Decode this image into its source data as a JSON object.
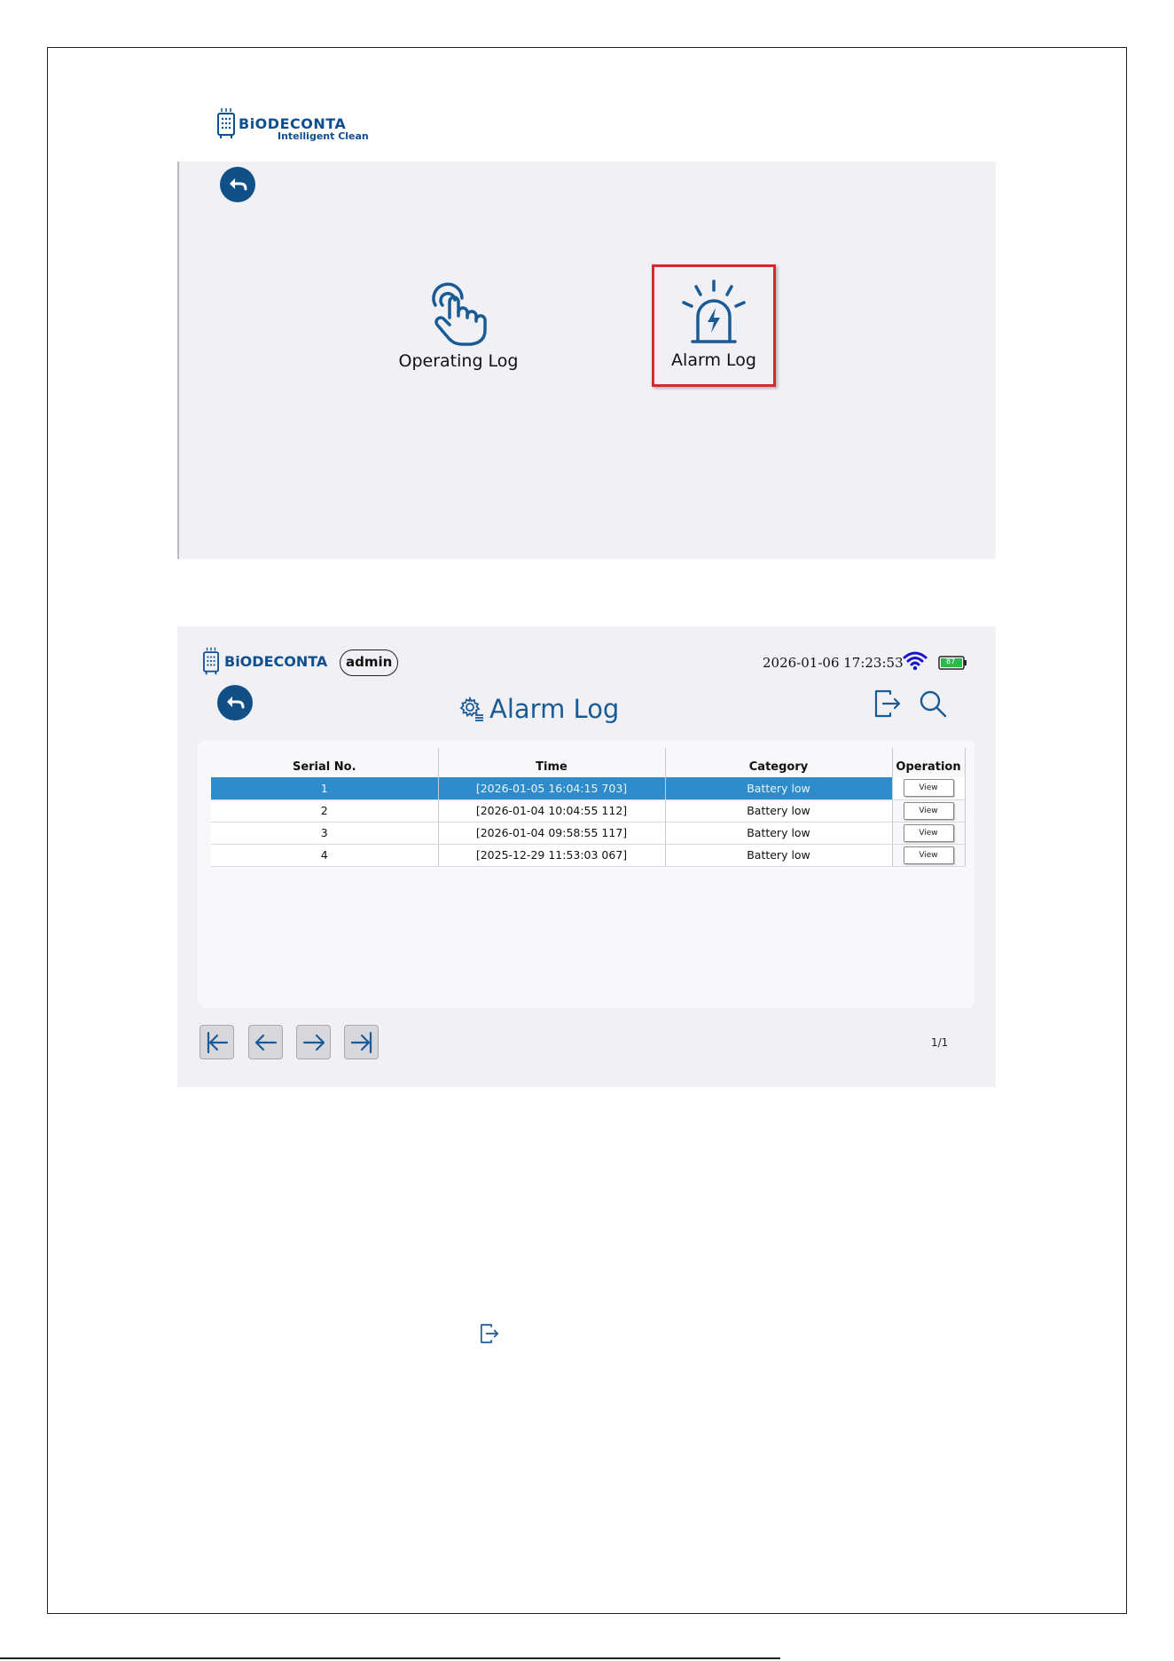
{
  "colors": {
    "brand": "#0f4f8f",
    "title": "#1a5b96",
    "selected_row": "#2f8ccb",
    "highlight_border": "#d42a2a",
    "panel_bg": "#f1f1f5"
  },
  "logo": {
    "brand": "BiODECONTA",
    "tagline": "Intelligent Clean"
  },
  "menu_screen": {
    "back_icon": "back-arrow-icon",
    "tiles": [
      {
        "label": "Operating Log",
        "icon": "hand-pointer-icon",
        "selected": false
      },
      {
        "label": "Alarm Log",
        "icon": "alarm-siren-icon",
        "selected": true
      }
    ]
  },
  "alarm_screen": {
    "header": {
      "brand": "BiODECONTA",
      "user": "admin",
      "datetime": "2026-01-06 17:23:53",
      "battery_level": "87",
      "wifi_icon": "wifi-icon",
      "battery_icon": "battery-icon"
    },
    "title": "Alarm Log",
    "title_icon": "gear-list-icon",
    "toolbar_icons": [
      "export-icon",
      "search-icon"
    ],
    "table": {
      "columns": [
        "Serial No.",
        "Time",
        "Category",
        "Operation"
      ],
      "rows": [
        {
          "serial": "1",
          "time": "[2026-01-05 16:04:15 703]",
          "category": "Battery low",
          "action": "View",
          "selected": true
        },
        {
          "serial": "2",
          "time": "[2026-01-04 10:04:55 112]",
          "category": "Battery low",
          "action": "View",
          "selected": false
        },
        {
          "serial": "3",
          "time": "[2026-01-04 09:58:55 117]",
          "category": "Battery low",
          "action": "View",
          "selected": false
        },
        {
          "serial": "4",
          "time": "[2025-12-29 11:53:03 067]",
          "category": "Battery low",
          "action": "View",
          "selected": false
        }
      ]
    },
    "pagination": {
      "icons": [
        "first-page-icon",
        "prev-page-icon",
        "next-page-icon",
        "last-page-icon"
      ],
      "page": "1/1"
    }
  },
  "footer_icon": "export-icon"
}
